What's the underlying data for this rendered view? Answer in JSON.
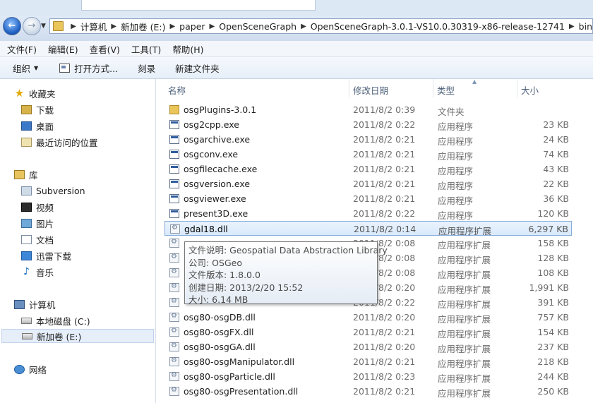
{
  "address_bar": {
    "breadcrumb": [
      "计算机",
      "新加卷 (E:)",
      "paper",
      "OpenSceneGraph",
      "OpenSceneGraph-3.0.1-VS10.0.30319-x86-release-12741",
      "bin"
    ],
    "back_glyph": "←",
    "forward_glyph": "→"
  },
  "menu": [
    "文件(F)",
    "编辑(E)",
    "查看(V)",
    "工具(T)",
    "帮助(H)"
  ],
  "toolbar": {
    "organize": "组织",
    "open_with": "打开方式...",
    "burn": "刻录",
    "new_folder": "新建文件夹"
  },
  "nav": {
    "favorites": "收藏夹",
    "downloads": "下载",
    "desktop": "桌面",
    "recent": "最近访问的位置",
    "libraries": "库",
    "subversion": "Subversion",
    "video": "视频",
    "pictures": "图片",
    "documents": "文档",
    "thunder": "迅雷下载",
    "music": "音乐",
    "computer": "计算机",
    "local_disk": "本地磁盘 (C:)",
    "new_volume": "新加卷 (E:)",
    "network": "网络"
  },
  "columns": {
    "name": "名称",
    "date": "修改日期",
    "type": "类型",
    "size": "大小"
  },
  "files": [
    {
      "name": "osgPlugins-3.0.1",
      "date": "2011/8/2 0:39",
      "type": "文件夹",
      "size": "",
      "icon": "folder-icon"
    },
    {
      "name": "osg2cpp.exe",
      "date": "2011/8/2 0:22",
      "type": "应用程序",
      "size": "23 KB",
      "icon": "exe-icon"
    },
    {
      "name": "osgarchive.exe",
      "date": "2011/8/2 0:21",
      "type": "应用程序",
      "size": "24 KB",
      "icon": "exe-icon"
    },
    {
      "name": "osgconv.exe",
      "date": "2011/8/2 0:21",
      "type": "应用程序",
      "size": "74 KB",
      "icon": "exe-icon"
    },
    {
      "name": "osgfilecache.exe",
      "date": "2011/8/2 0:21",
      "type": "应用程序",
      "size": "43 KB",
      "icon": "exe-icon"
    },
    {
      "name": "osgversion.exe",
      "date": "2011/8/2 0:21",
      "type": "应用程序",
      "size": "22 KB",
      "icon": "exe-icon"
    },
    {
      "name": "osgviewer.exe",
      "date": "2011/8/2 0:21",
      "type": "应用程序",
      "size": "36 KB",
      "icon": "exe-icon"
    },
    {
      "name": "present3D.exe",
      "date": "2011/8/2 0:22",
      "type": "应用程序",
      "size": "120 KB",
      "icon": "exe-icon"
    },
    {
      "name": "gdal18.dll",
      "date": "2011/8/2 0:14",
      "type": "应用程序扩展",
      "size": "6,297 KB",
      "icon": "dll-icon"
    },
    {
      "name": "",
      "date": "2011/8/2 0:08",
      "type": "应用程序扩展",
      "size": "158 KB",
      "icon": "dll-icon"
    },
    {
      "name": "",
      "date": "2011/8/2 0:08",
      "type": "应用程序扩展",
      "size": "128 KB",
      "icon": "dll-icon"
    },
    {
      "name": "",
      "date": "2011/8/2 0:08",
      "type": "应用程序扩展",
      "size": "108 KB",
      "icon": "dll-icon"
    },
    {
      "name": "",
      "date": "2011/8/2 0:20",
      "type": "应用程序扩展",
      "size": "1,991 KB",
      "icon": "dll-icon"
    },
    {
      "name": "",
      "date": "2011/8/2 0:22",
      "type": "应用程序扩展",
      "size": "391 KB",
      "icon": "dll-icon"
    },
    {
      "name": "osg80-osgDB.dll",
      "date": "2011/8/2 0:20",
      "type": "应用程序扩展",
      "size": "757 KB",
      "icon": "dll-icon"
    },
    {
      "name": "osg80-osgFX.dll",
      "date": "2011/8/2 0:21",
      "type": "应用程序扩展",
      "size": "154 KB",
      "icon": "dll-icon"
    },
    {
      "name": "osg80-osgGA.dll",
      "date": "2011/8/2 0:20",
      "type": "应用程序扩展",
      "size": "237 KB",
      "icon": "dll-icon"
    },
    {
      "name": "osg80-osgManipulator.dll",
      "date": "2011/8/2 0:21",
      "type": "应用程序扩展",
      "size": "218 KB",
      "icon": "dll-icon"
    },
    {
      "name": "osg80-osgParticle.dll",
      "date": "2011/8/2 0:23",
      "type": "应用程序扩展",
      "size": "244 KB",
      "icon": "dll-icon"
    },
    {
      "name": "osg80-osgPresentation.dll",
      "date": "2011/8/2 0:21",
      "type": "应用程序扩展",
      "size": "250 KB",
      "icon": "dll-icon"
    }
  ],
  "tooltip": {
    "description": "文件说明: Geospatial Data Abstraction Library",
    "company": "公司: OSGeo",
    "version": "文件版本: 1.8.0.0",
    "created": "创建日期: 2013/2/20 15:52",
    "size": "大小: 6.14 MB"
  }
}
